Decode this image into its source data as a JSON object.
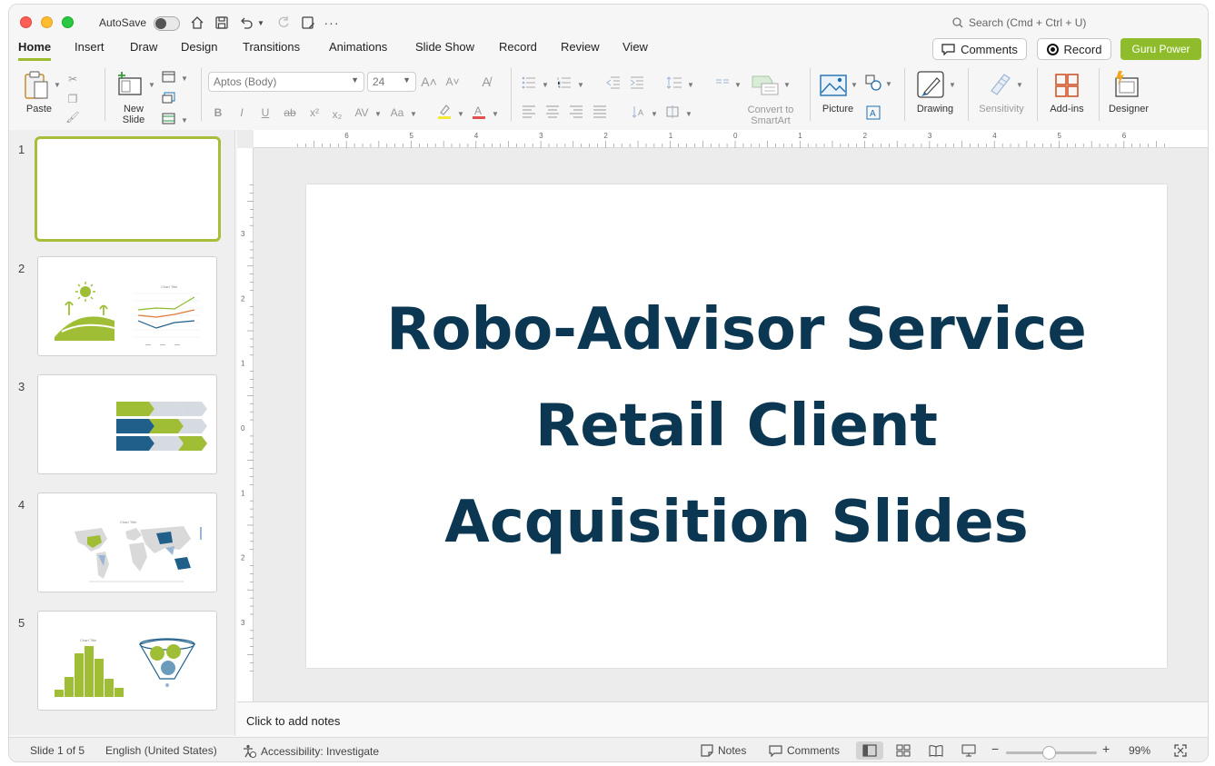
{
  "titlebar": {
    "autosave_label": "AutoSave",
    "search_placeholder": "Search (Cmd + Ctrl + U)"
  },
  "tabs": [
    "Home",
    "Insert",
    "Draw",
    "Design",
    "Transitions",
    "Animations",
    "Slide Show",
    "Record",
    "Review",
    "View"
  ],
  "header_buttons": {
    "comments": "Comments",
    "record": "Record",
    "guru": "Guru Power"
  },
  "ribbon": {
    "paste": "Paste",
    "new_slide": "New\nSlide",
    "font_name": "Aptos (Body)",
    "font_size": "24",
    "convert_smartart": "Convert to\nSmartArt",
    "picture": "Picture",
    "drawing": "Drawing",
    "sensitivity": "Sensitivity",
    "addins": "Add-ins",
    "designer": "Designer",
    "bold": "B",
    "italic": "I",
    "underline": "U",
    "strike": "ab",
    "superscript": "x²",
    "subscript": "x₂",
    "spacing": "AV",
    "case": "Aa"
  },
  "thumbnails": [
    {
      "num": "1"
    },
    {
      "num": "2",
      "chart_title": "Chart Title"
    },
    {
      "num": "3"
    },
    {
      "num": "4",
      "chart_title": "Chart Title"
    },
    {
      "num": "5",
      "chart_title": "Chart Title"
    }
  ],
  "ruler": {
    "h_ticks": [
      "6",
      "5",
      "4",
      "3",
      "2",
      "1",
      "0",
      "1",
      "2",
      "3",
      "4",
      "5",
      "6"
    ],
    "v_ticks": [
      "3",
      "2",
      "1",
      "0",
      "1",
      "2",
      "3"
    ]
  },
  "slide": {
    "title_lines": [
      "Robo-Advisor Service",
      "Retail Client",
      "Acquisition Slides"
    ]
  },
  "notes": {
    "placeholder": "Click to add notes"
  },
  "status": {
    "slide_count": "Slide 1 of 5",
    "language": "English (United States)",
    "accessibility": "Accessibility: Investigate",
    "notes": "Notes",
    "comments": "Comments",
    "zoom": "99%"
  },
  "colors": {
    "accent_green": "#9cbc2e",
    "title_navy": "#0c3752",
    "guru_green": "#8fbc2b"
  }
}
